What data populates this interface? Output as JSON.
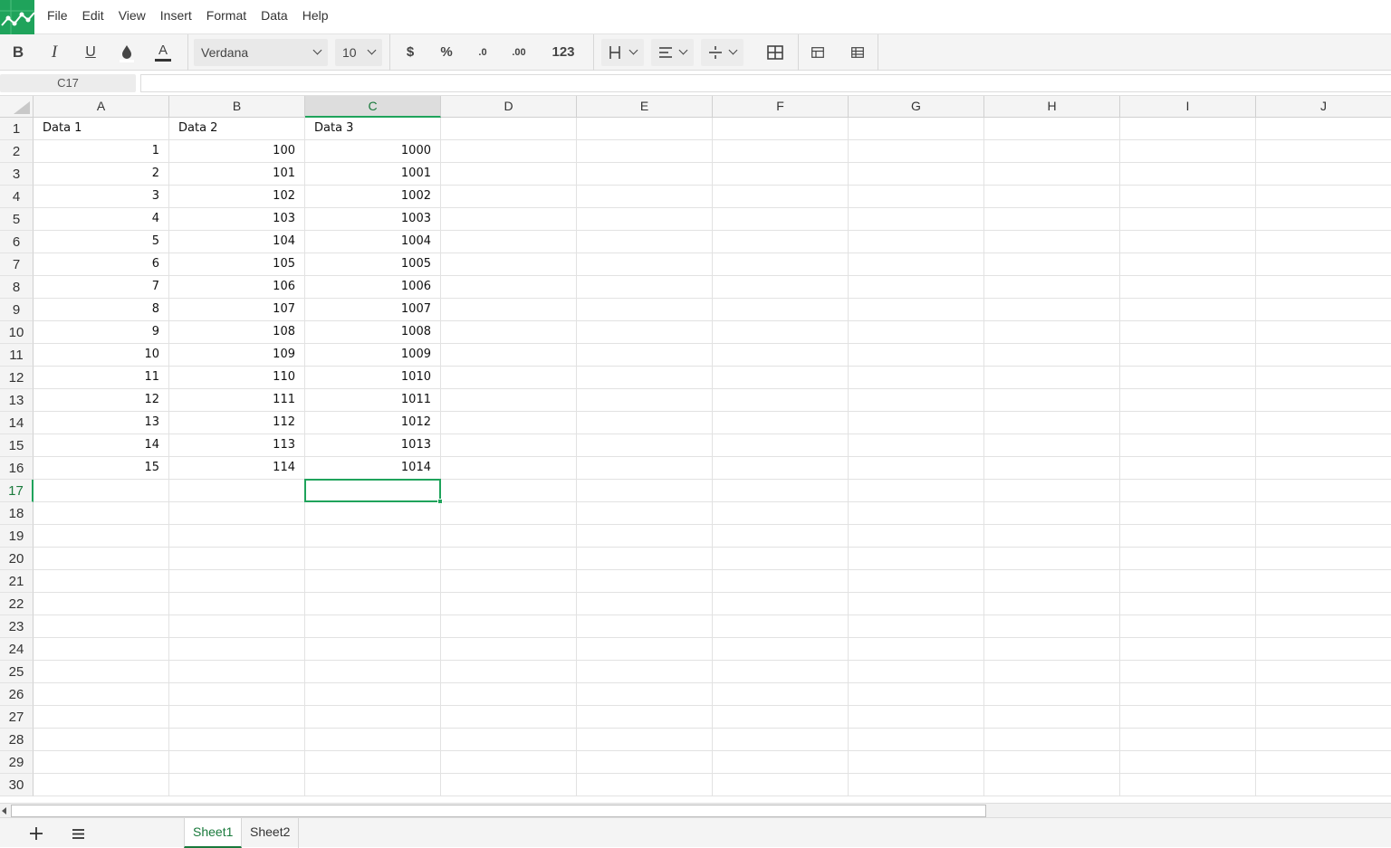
{
  "menu": {
    "items": [
      "File",
      "Edit",
      "View",
      "Insert",
      "Format",
      "Data",
      "Help"
    ]
  },
  "toolbar": {
    "bold": "B",
    "italic": "I",
    "underline": "U",
    "text_color_glyph": "A",
    "font_family": "Verdana",
    "font_size": "10",
    "currency": "$",
    "percent": "%",
    "decrease_decimal": ".0",
    "increase_decimal": ".00",
    "number_format": "123"
  },
  "formula_bar": {
    "name_box": "C17",
    "formula": ""
  },
  "grid": {
    "columns": [
      "A",
      "B",
      "C",
      "D",
      "E",
      "F",
      "G",
      "H",
      "I",
      "J"
    ],
    "selected_column": "C",
    "selected_row": "17",
    "row_numbers": [
      "1",
      "2",
      "3",
      "4",
      "5",
      "6",
      "7",
      "8",
      "9",
      "10",
      "11",
      "12",
      "13",
      "14",
      "15",
      "16",
      "17",
      "18",
      "19",
      "20",
      "21",
      "22",
      "23",
      "24",
      "25",
      "26",
      "27",
      "28",
      "29",
      "30"
    ],
    "header_row": [
      "Data 1",
      "Data 2",
      "Data 3"
    ],
    "rows": [
      [
        "1",
        "100",
        "1000"
      ],
      [
        "2",
        "101",
        "1001"
      ],
      [
        "3",
        "102",
        "1002"
      ],
      [
        "4",
        "103",
        "1003"
      ],
      [
        "5",
        "104",
        "1004"
      ],
      [
        "6",
        "105",
        "1005"
      ],
      [
        "7",
        "106",
        "1006"
      ],
      [
        "8",
        "107",
        "1007"
      ],
      [
        "9",
        "108",
        "1008"
      ],
      [
        "10",
        "109",
        "1009"
      ],
      [
        "11",
        "110",
        "1010"
      ],
      [
        "12",
        "111",
        "1011"
      ],
      [
        "13",
        "112",
        "1012"
      ],
      [
        "14",
        "113",
        "1013"
      ],
      [
        "15",
        "114",
        "1014"
      ]
    ]
  },
  "sheets": {
    "tabs": [
      "Sheet1",
      "Sheet2"
    ],
    "active": "Sheet1"
  },
  "colors": {
    "accent": "#1fa35b",
    "accent_text": "#1a7a3c"
  }
}
